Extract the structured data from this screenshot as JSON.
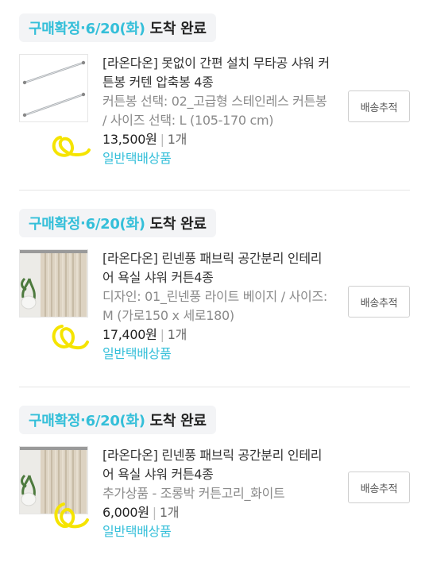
{
  "orders": [
    {
      "status": "구매확정",
      "dot": " · ",
      "date": "6/20(화)",
      "arrival": "도착 완료",
      "title": "[라온다온] 못없이 간편 설치 무타공 샤워 커튼봉 커텐 압축봉 4종",
      "option": "커튼봉 선택: 02_고급형 스테인레스 커튼봉 / 사이즈 선택: L (105-170 cm)",
      "price": "13,500원",
      "quantity": "1개",
      "shipping": "일반택배상품",
      "track_label": "배송추적",
      "thumb_icon": "curtain-rod-thumbnail"
    },
    {
      "status": "구매확정",
      "dot": " · ",
      "date": "6/20(화)",
      "arrival": "도착 완료",
      "title": "[라온다온] 린넨풍 패브릭 공간분리 인테리어 욕실 샤워 커튼4종",
      "option": "디자인: 01_린넨풍 라이트 베이지 / 사이즈: M (가로150 x 세로180)",
      "price": "17,400원",
      "quantity": "1개",
      "shipping": "일반택배상품",
      "track_label": "배송추적",
      "thumb_icon": "linen-curtain-thumbnail"
    },
    {
      "status": "구매확정",
      "dot": " · ",
      "date": "6/20(화)",
      "arrival": "도착 완료",
      "title": "[라온다온] 린넨풍 패브릭 공간분리 인테리어 욕실 샤워 커튼4종",
      "option": "추가상품 - 조롱박 커튼고리_화이트",
      "price": "6,000원",
      "quantity": "1개",
      "shipping": "일반택배상품",
      "track_label": "배송추적",
      "thumb_icon": "linen-curtain-thumbnail"
    }
  ],
  "colors": {
    "accent": "#34bfd9",
    "scribble": "#f5e400",
    "badge_bg": "#f3f4f6"
  }
}
